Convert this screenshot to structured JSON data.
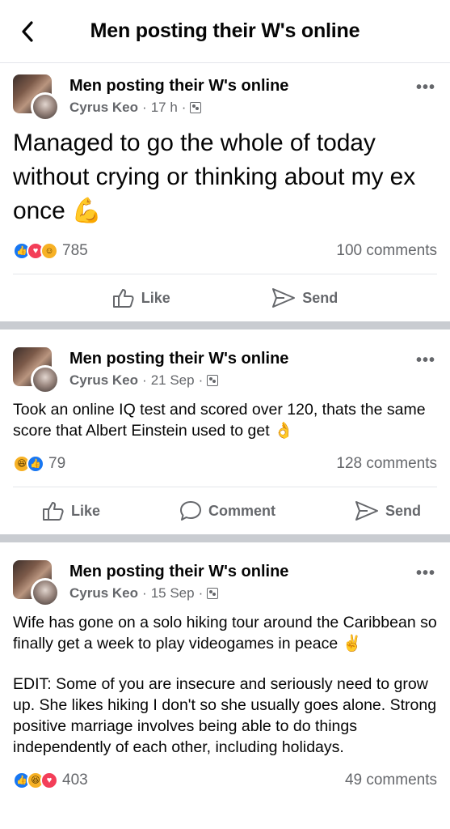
{
  "header": {
    "title": "Men posting their W's online"
  },
  "posts": [
    {
      "group": "Men posting their W's online",
      "author": "Cyrus Keo",
      "time": "17 h",
      "paragraphs": [
        "Managed to go the whole of today without crying or thinking about my ex once 💪"
      ],
      "reaction_count": "785",
      "comments": "100 comments",
      "actions": {
        "like": "Like",
        "send": "Send"
      },
      "reaction_icons": [
        "like-icon",
        "love-icon",
        "care-icon"
      ]
    },
    {
      "group": "Men posting their W's online",
      "author": "Cyrus Keo",
      "time": "21 Sep",
      "paragraphs": [
        "Took an online IQ test and scored over 120, thats the same score that Albert Einstein used to get 👌"
      ],
      "reaction_count": "79",
      "comments": "128 comments",
      "actions": {
        "like": "Like",
        "comment": "Comment",
        "send": "Send"
      },
      "reaction_icons": [
        "haha-icon",
        "like-icon"
      ]
    },
    {
      "group": "Men posting their W's online",
      "author": "Cyrus Keo",
      "time": "15 Sep",
      "paragraphs": [
        "Wife has gone on a solo hiking tour around the Caribbean so finally get a week to play videogames in peace ✌️",
        "EDIT: Some of you are insecure and seriously need to grow up. She likes hiking I don't so she usually goes alone. Strong positive marriage involves being able to do things independently of each other, including holidays."
      ],
      "reaction_count": "403",
      "comments": "49 comments",
      "reaction_icons": [
        "like-icon",
        "haha-icon",
        "love-icon"
      ]
    }
  ],
  "colors": {
    "like": "#1877f2",
    "love": "#f33e58",
    "haha": "#f7b125",
    "secondary_text": "#65676b",
    "separator": "#c9ccd1"
  }
}
